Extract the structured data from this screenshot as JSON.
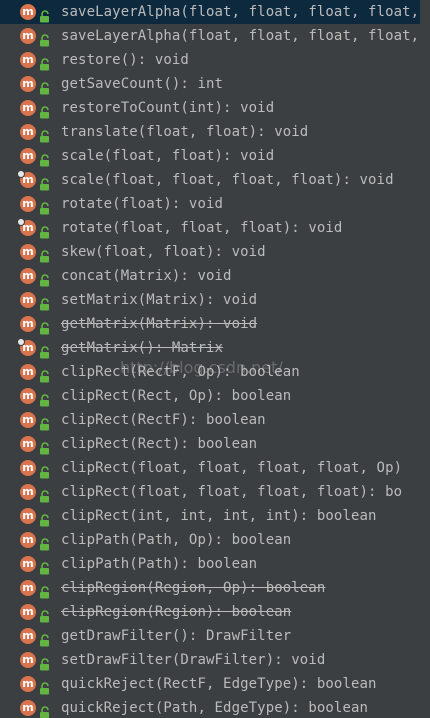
{
  "colors": {
    "background": "#3c3f41",
    "selected_row": "#0d293e",
    "text": "#bbbbbb",
    "method_icon": "#d9744d",
    "lock_icon": "#62b543"
  },
  "icons": {
    "method": "method-icon",
    "visibility": "public-lock-icon"
  },
  "items": [
    {
      "label": "saveLayerAlpha(float, float, float, float,",
      "selected": true,
      "deprecated": false,
      "overridden": false
    },
    {
      "label": "saveLayerAlpha(float, float, float, float,",
      "selected": false,
      "deprecated": false,
      "overridden": false
    },
    {
      "label": "restore(): void",
      "selected": false,
      "deprecated": false,
      "overridden": false
    },
    {
      "label": "getSaveCount(): int",
      "selected": false,
      "deprecated": false,
      "overridden": false
    },
    {
      "label": "restoreToCount(int): void",
      "selected": false,
      "deprecated": false,
      "overridden": false
    },
    {
      "label": "translate(float, float): void",
      "selected": false,
      "deprecated": false,
      "overridden": false
    },
    {
      "label": "scale(float, float): void",
      "selected": false,
      "deprecated": false,
      "overridden": false
    },
    {
      "label": "scale(float, float, float, float): void",
      "selected": false,
      "deprecated": false,
      "overridden": true
    },
    {
      "label": "rotate(float): void",
      "selected": false,
      "deprecated": false,
      "overridden": false
    },
    {
      "label": "rotate(float, float, float): void",
      "selected": false,
      "deprecated": false,
      "overridden": true
    },
    {
      "label": "skew(float, float): void",
      "selected": false,
      "deprecated": false,
      "overridden": false
    },
    {
      "label": "concat(Matrix): void",
      "selected": false,
      "deprecated": false,
      "overridden": false
    },
    {
      "label": "setMatrix(Matrix): void",
      "selected": false,
      "deprecated": false,
      "overridden": false
    },
    {
      "label": "getMatrix(Matrix): void",
      "selected": false,
      "deprecated": true,
      "overridden": false
    },
    {
      "label": "getMatrix(): Matrix",
      "selected": false,
      "deprecated": true,
      "overridden": true
    },
    {
      "label": "clipRect(RectF, Op): boolean",
      "selected": false,
      "deprecated": false,
      "overridden": false
    },
    {
      "label": "clipRect(Rect, Op): boolean",
      "selected": false,
      "deprecated": false,
      "overridden": false
    },
    {
      "label": "clipRect(RectF): boolean",
      "selected": false,
      "deprecated": false,
      "overridden": false
    },
    {
      "label": "clipRect(Rect): boolean",
      "selected": false,
      "deprecated": false,
      "overridden": false
    },
    {
      "label": "clipRect(float, float, float, float, Op)",
      "selected": false,
      "deprecated": false,
      "overridden": false
    },
    {
      "label": "clipRect(float, float, float, float): bo",
      "selected": false,
      "deprecated": false,
      "overridden": false
    },
    {
      "label": "clipRect(int, int, int, int): boolean",
      "selected": false,
      "deprecated": false,
      "overridden": false
    },
    {
      "label": "clipPath(Path, Op): boolean",
      "selected": false,
      "deprecated": false,
      "overridden": false
    },
    {
      "label": "clipPath(Path): boolean",
      "selected": false,
      "deprecated": false,
      "overridden": false
    },
    {
      "label": "clipRegion(Region, Op): boolean",
      "selected": false,
      "deprecated": true,
      "overridden": false
    },
    {
      "label": "clipRegion(Region): boolean",
      "selected": false,
      "deprecated": true,
      "overridden": false
    },
    {
      "label": "getDrawFilter(): DrawFilter",
      "selected": false,
      "deprecated": false,
      "overridden": false
    },
    {
      "label": "setDrawFilter(DrawFilter): void",
      "selected": false,
      "deprecated": false,
      "overridden": false
    },
    {
      "label": "quickReject(RectF, EdgeType): boolean",
      "selected": false,
      "deprecated": false,
      "overridden": false
    },
    {
      "label": "quickReject(Path, EdgeType): boolean",
      "selected": false,
      "deprecated": false,
      "overridden": false
    }
  ],
  "watermark": "http://blog.csdn.net/"
}
